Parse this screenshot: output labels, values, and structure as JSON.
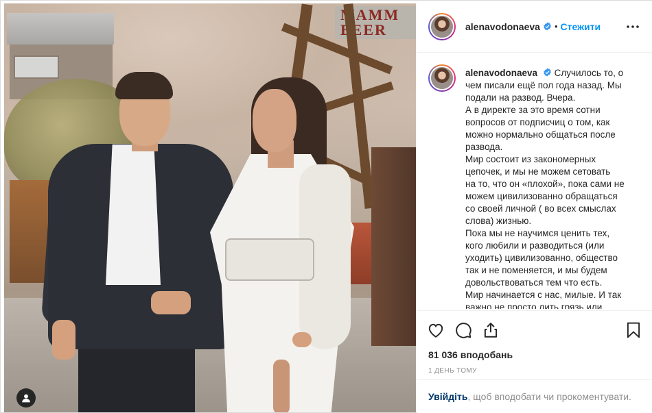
{
  "post": {
    "username": "alenavodonaeva",
    "follow_label": "Стежити",
    "separator": "•",
    "caption_lines": [
      "Случилось то, о",
      "чем писали ещё пол года назад. Мы",
      "подали на развод. Вчера.",
      "А в директе за это время сотни",
      "вопросов от подписчиц о том, как",
      "можно нормально общаться после",
      "развода.",
      "Мир состоит из закономерных",
      "цепочек, и мы не можем сетовать",
      "на то, что он «плохой», пока сами не",
      "можем цивилизованно обращаться",
      "со своей личной ( во всех смыслах",
      "слова) жизнью.",
      "Пока мы не научимся ценить тех,",
      "кого любили и разводиться (или",
      "уходить) цивилизованно, общество",
      "так и не поменяется, и мы будем",
      "довольствоваться тем что есть.",
      "Мир начинается с нас, милые. И так",
      "важно не просто лить грязь или"
    ],
    "likes": "81 036 вподобань",
    "time_ago": "1 ДЕНЬ ТОМУ"
  },
  "login_prompt": {
    "link": "Увійдіть",
    "text": ", щоб вподобати чи прокоментувати."
  },
  "photo_sign": "MAMM BEER",
  "icons": {
    "verified": "verified-badge-icon",
    "more": "more-options-icon",
    "like": "heart-icon",
    "comment": "comment-icon",
    "share": "share-icon",
    "save": "bookmark-icon",
    "tagged": "user-tag-icon"
  },
  "colors": {
    "accent": "#0095f6",
    "link_dark": "#00376b",
    "text": "#262626",
    "muted": "#8e8e8e"
  }
}
